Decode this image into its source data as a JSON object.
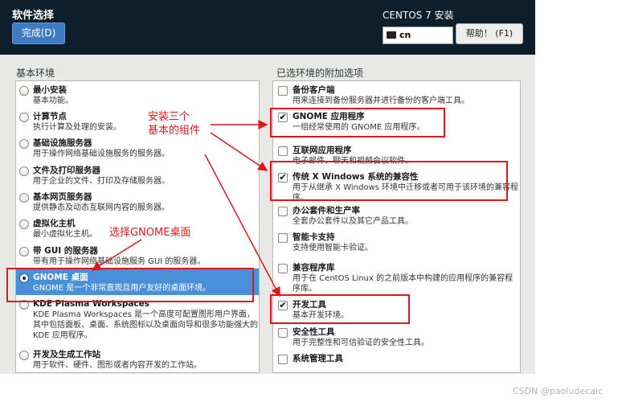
{
  "header": {
    "title": "软件选择",
    "done_label": "完成(D)",
    "product": "CENTOS 7 安装",
    "keyboard_layout": "cn",
    "help_label": "帮助！ (F1)"
  },
  "left_panel": {
    "title": "基本环境",
    "items": [
      {
        "name": "最小安装",
        "desc": "基本功能。"
      },
      {
        "name": "计算节点",
        "desc": "执行计算及处理的安装。"
      },
      {
        "name": "基础设施服务器",
        "desc": "用于操作网络基础设施服务的服务器。"
      },
      {
        "name": "文件及打印服务器",
        "desc": "用于企业的文件、打印及存储服务器。"
      },
      {
        "name": "基本网页服务器",
        "desc": "提供静态及动态互联网内容的服务器。"
      },
      {
        "name": "虚拟化主机",
        "desc": "最小虚拟化主机。"
      },
      {
        "name": "带 GUI 的服务器",
        "desc": "带有用于操作网络基础设施服务 GUI 的服务器。"
      },
      {
        "name": "GNOME 桌面",
        "desc": "GNOME 是一个非常直观且用户友好的桌面环境。",
        "selected": true
      },
      {
        "name": "KDE Plasma Workspaces",
        "desc": "KDE Plasma Workspaces 是一个高度可配置图形用户界面，其中包括面板、桌面、系统图标以及桌面向导和很多功能强大的 KDE 应用程序。"
      },
      {
        "name": "开发及生成工作站",
        "desc": "用于软件、硬件、图形或者内容开发的工作站。"
      }
    ]
  },
  "right_panel": {
    "title": "已选环境的附加选项",
    "items": [
      {
        "name": "备份客户端",
        "desc": "用来连接到备份服务器并进行备份的客户端工具。",
        "checked": false
      },
      {
        "name": "GNOME 应用程序",
        "desc": "一组经常使用的 GNOME 应用程序。",
        "checked": true
      },
      {
        "name": "互联网应用程序",
        "desc": "电子邮件、聊天和视频会议软件。",
        "checked": false
      },
      {
        "name": "传统 X Windows 系统的兼容性",
        "desc": "用于从继承 X Windows 环境中迁移或者可用于该环境的兼容程序。",
        "checked": true
      },
      {
        "name": "办公套件和生产率",
        "desc": "全套办公套件以及其它产品工具。",
        "checked": false
      },
      {
        "name": "智能卡支持",
        "desc": "支持使用智能卡验证。",
        "checked": false
      },
      {
        "name": "兼容程序库",
        "desc": "用于在 CentOS Linux 的之前版本中构建的应用程序的兼容程序库。",
        "checked": false
      },
      {
        "name": "开发工具",
        "desc": "基本开发环境。",
        "checked": true
      },
      {
        "name": "安全性工具",
        "desc": "用于完整性和可信验证的安全性工具。",
        "checked": false
      },
      {
        "name": "系统管理工具",
        "desc": "",
        "checked": false
      }
    ]
  },
  "annotations": {
    "components": "安装三个\n基本的组件",
    "gnome": "选择GNOME桌面"
  },
  "watermark": "CSDN @paoludecaic",
  "colors": {
    "header_bg": "#0d1f2d",
    "accent": "#4a90d9",
    "annotation_red": "#e0161b"
  }
}
